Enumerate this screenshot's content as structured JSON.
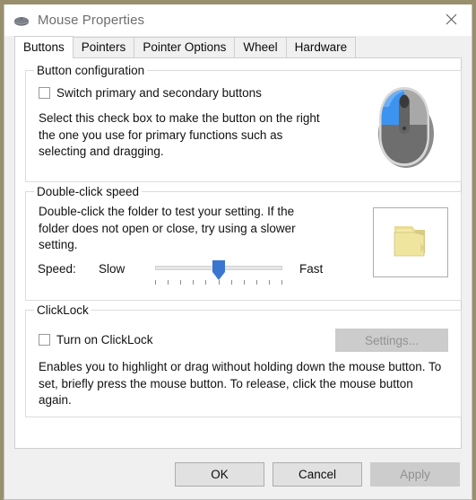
{
  "window": {
    "title": "Mouse Properties",
    "icon": "mouse-icon",
    "close_icon": "close-icon"
  },
  "tabs": [
    {
      "label": "Buttons",
      "active": true
    },
    {
      "label": "Pointers",
      "active": false
    },
    {
      "label": "Pointer Options",
      "active": false
    },
    {
      "label": "Wheel",
      "active": false
    },
    {
      "label": "Hardware",
      "active": false
    }
  ],
  "button_configuration": {
    "group_label": "Button configuration",
    "switch_checkbox": {
      "label": "Switch primary and secondary buttons",
      "checked": false
    },
    "description": "Select this check box to make the button on the right the one you use for primary functions such as selecting and dragging.",
    "illustration": "mouse-illustration",
    "illustration_highlight_color": "#3c94f0",
    "illustration_body_color": "#7d7d7d"
  },
  "double_click_speed": {
    "group_label": "Double-click speed",
    "description": "Double-click the folder to test your setting. If the folder does not open or close, try using a slower setting.",
    "speed_caption": "Speed:",
    "slow_label": "Slow",
    "fast_label": "Fast",
    "slider": {
      "value": 50,
      "min": 0,
      "max": 100,
      "tick_count": 11,
      "thumb_color": "#3a76d0",
      "track_color": "#e6e6e6"
    },
    "test_area_icon": "folder-icon"
  },
  "clicklock": {
    "group_label": "ClickLock",
    "turn_on_checkbox": {
      "label": "Turn on ClickLock",
      "checked": false
    },
    "settings_button": {
      "label": "Settings...",
      "enabled": false
    },
    "description": "Enables you to highlight or drag without holding down the mouse button. To set, briefly press the mouse button. To release, click the mouse button again."
  },
  "footer": {
    "ok_label": "OK",
    "cancel_label": "Cancel",
    "apply_label": "Apply",
    "apply_enabled": false
  }
}
